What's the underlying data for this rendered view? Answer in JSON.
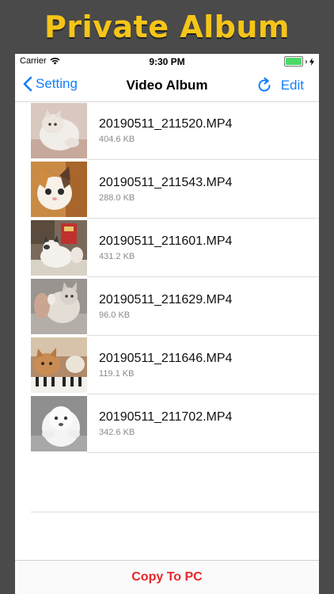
{
  "banner": {
    "title": "Private Album"
  },
  "status_bar": {
    "carrier": "Carrier",
    "time": "9:30 PM",
    "battery_level": 1.0
  },
  "nav": {
    "back_label": "Setting",
    "title": "Video Album",
    "edit_label": "Edit"
  },
  "videos": [
    {
      "name": "20190511_211520.MP4",
      "size": "404.6 KB"
    },
    {
      "name": "20190511_211543.MP4",
      "size": "288.0 KB"
    },
    {
      "name": "20190511_211601.MP4",
      "size": "431.2 KB"
    },
    {
      "name": "20190511_211629.MP4",
      "size": "96.0 KB"
    },
    {
      "name": "20190511_211646.MP4",
      "size": "119.1 KB"
    },
    {
      "name": "20190511_211702.MP4",
      "size": "342.6 KB"
    }
  ],
  "footer": {
    "copy_label": "Copy To PC"
  },
  "colors": {
    "accent": "#147efb",
    "banner_text": "#f5c518",
    "copy_text": "#e8262b",
    "battery": "#4cd964"
  }
}
